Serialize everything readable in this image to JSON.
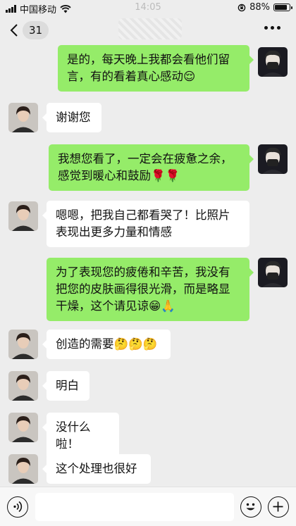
{
  "status_bar": {
    "carrier": "中国移动",
    "time": "14:05",
    "battery_percent": "88%",
    "battery_level": 0.88
  },
  "nav": {
    "unread_count": "31"
  },
  "messages": [
    {
      "side": "right",
      "text": "是的，每天晚上我都会看他们留言，有的看着真心感动😌"
    },
    {
      "side": "left",
      "text": "谢谢您"
    },
    {
      "side": "right",
      "text": "我想您看了，一定会在疲惫之余，感觉到暖心和鼓励🌹🌹"
    },
    {
      "side": "left",
      "text": "嗯嗯，把我自己都看哭了！比照片表现出更多力量和情感"
    },
    {
      "side": "right",
      "text": "为了表现您的疲倦和辛苦，我没有把您的皮肤画得很光滑，而是略显干燥，这个请见谅😁🙏"
    },
    {
      "side": "left",
      "text": "创造的需要🤔🤔🤔"
    },
    {
      "side": "left",
      "text": "明白"
    },
    {
      "side": "left",
      "text": "没什么啦！"
    },
    {
      "side": "left",
      "text": "这个处理也很好"
    }
  ],
  "input_bar": {
    "value": ""
  },
  "icons": {
    "back": "chevron-left-icon",
    "more": "more-dots-icon",
    "voice": "voice-icon",
    "emoji": "emoji-icon",
    "plus": "plus-icon"
  },
  "colors": {
    "background": "#ededed",
    "sent_bubble": "#95ec69",
    "received_bubble": "#ffffff"
  }
}
